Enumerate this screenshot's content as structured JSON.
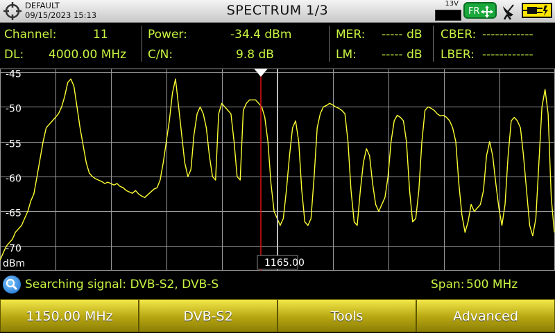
{
  "header": {
    "profile_name": "DEFAULT",
    "datetime": "09/15/2023 15:13",
    "title": "SPECTRUM 1/3",
    "voltage": "13V",
    "band_badge": "FR"
  },
  "measurements": {
    "channel": {
      "label": "Channel:",
      "value": "11"
    },
    "dl": {
      "label": "DL:",
      "value": "4000.00 MHz"
    },
    "power": {
      "label": "Power:",
      "value": "-34.4 dBm"
    },
    "cn": {
      "label": "C/N:",
      "value": "9.8 dB"
    },
    "mer": {
      "label": "MER:",
      "value": "----- dB"
    },
    "lm": {
      "label": "LM:",
      "value": "----- dB"
    },
    "cber": {
      "label": "CBER:",
      "value": "------------"
    },
    "lber": {
      "label": "LBER:",
      "value": "------------"
    }
  },
  "chart_data": {
    "type": "line",
    "ylabel": "dBm",
    "y_ticks": [
      "-45",
      "-50",
      "-55",
      "-60",
      "-65",
      "-70"
    ],
    "ylim": [
      -73.5,
      -44.5
    ],
    "marker_label": "1165.00",
    "colors": {
      "trace": "#ffff33",
      "grid": "#9a9a9a",
      "marker": "#e01010",
      "cursor": "#bbbbbb"
    },
    "series": [
      {
        "values": [
          -72,
          -71,
          -70,
          -69.5,
          -69,
          -68,
          -67.5,
          -67,
          -66,
          -65,
          -63.5,
          -62.5,
          -60,
          -57.5,
          -55,
          -53,
          -52.5,
          -52,
          -51.5,
          -51,
          -50,
          -48.5,
          -46.5,
          -46,
          -47,
          -50,
          -53,
          -55.5,
          -58,
          -59.5,
          -60,
          -60.3,
          -60.5,
          -60.7,
          -61,
          -60.8,
          -61,
          -61.2,
          -61,
          -61.4,
          -61.6,
          -62,
          -62.2,
          -62.4,
          -62,
          -62.5,
          -62.8,
          -63,
          -62.6,
          -62.2,
          -61.8,
          -61.6,
          -60.5,
          -58,
          -55,
          -52,
          -48,
          -46,
          -50,
          -54,
          -58,
          -60,
          -59,
          -54,
          -51,
          -50,
          -51,
          -53,
          -57,
          -60,
          -60.5,
          -51,
          -49.5,
          -50,
          -50.5,
          -51,
          -55,
          -60,
          -60.5,
          -50.5,
          -49.5,
          -49,
          -49,
          -49,
          -49.5,
          -50,
          -51.5,
          -55,
          -61,
          -65,
          -66,
          -67,
          -66,
          -62,
          -57,
          -53,
          -52,
          -55,
          -62,
          -66.5,
          -67,
          -66,
          -60,
          -53,
          -51,
          -50,
          -49.8,
          -49.5,
          -49.7,
          -50,
          -50.2,
          -50.5,
          -51,
          -55,
          -62,
          -66.5,
          -67,
          -62,
          -58,
          -56,
          -57,
          -61,
          -64,
          -65,
          -64,
          -63,
          -60,
          -55,
          -52,
          -51.2,
          -51.5,
          -52,
          -55,
          -62,
          -66.5,
          -66,
          -62,
          -55,
          -50.5,
          -50,
          -50.2,
          -50.5,
          -51,
          -51.3,
          -51.2,
          -51.5,
          -52,
          -53,
          -55,
          -61,
          -65.5,
          -68,
          -66.5,
          -64,
          -65,
          -64.5,
          -64,
          -62,
          -57,
          -55,
          -57,
          -61,
          -64.5,
          -67,
          -64,
          -57,
          -52,
          -51.5,
          -52,
          -53,
          -57,
          -62,
          -67,
          -68.5,
          -66,
          -58,
          -50,
          -47.5,
          -51,
          -63,
          -68
        ]
      }
    ]
  },
  "status": {
    "message": "Searching signal: DVB-S2, DVB-S",
    "span_label": "Span:",
    "span_value": "500 MHz"
  },
  "softkeys": [
    {
      "label": "1150.00 MHz"
    },
    {
      "label": "DVB-S2"
    },
    {
      "label": "Tools"
    },
    {
      "label": "Advanced"
    }
  ]
}
